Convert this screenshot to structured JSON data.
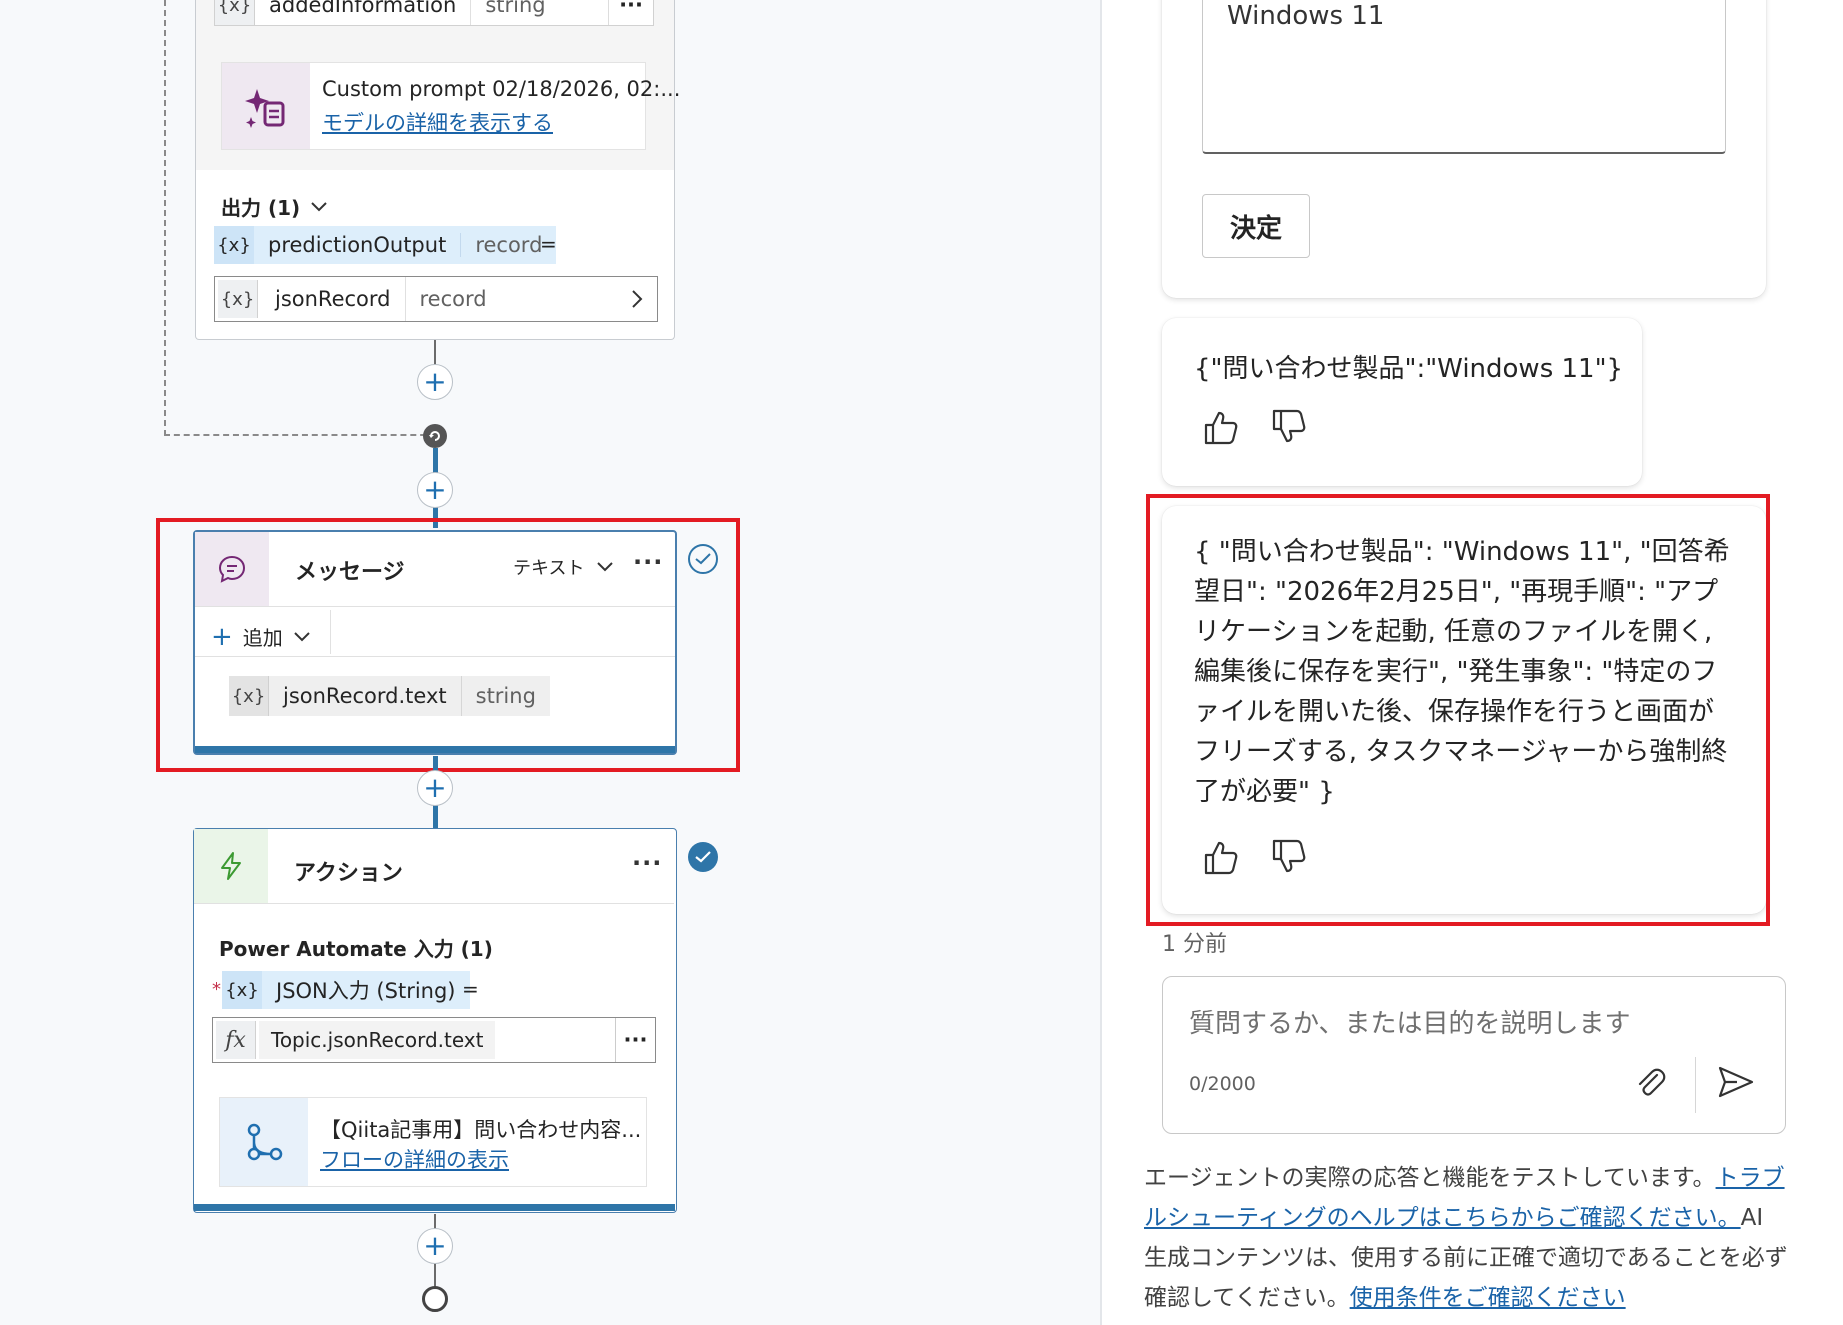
{
  "canvas": {
    "top_node": {
      "var_name": "addedInformation",
      "var_type": "string",
      "prompt_title": "Custom prompt 02/18/2026, 02:...",
      "prompt_link": "モデルの詳細を表示する",
      "output_label": "出力 (1)",
      "output_var": "predictionOutput",
      "output_type": "record",
      "eq": "=",
      "assign_var": "jsonRecord",
      "assign_type": "record"
    },
    "message_node": {
      "title": "メッセージ",
      "mode": "テキスト",
      "add_label": "追加",
      "var_name": "jsonRecord.text",
      "var_type": "string"
    },
    "action_node": {
      "title": "アクション",
      "inputs_label": "Power Automate 入力 (1)",
      "required_mark": "*",
      "input_name": "JSON入力 (String)",
      "eq": "=",
      "formula": "Topic.jsonRecord.text",
      "flow_title": "【Qiita記事用】問い合わせ内容...",
      "flow_link": "フローの詳細の表示"
    },
    "var_symbol": "{x}",
    "fx_symbol": "fx",
    "ellipsis": "···"
  },
  "panel": {
    "input_value": "Windows 11",
    "submit_label": "決定",
    "msg1": "{\"問い合わせ製品\":\"Windows 11\"}",
    "msg2": "{ \"問い合わせ製品\": \"Windows 11\", \"回答希望日\": \"2026年2月25日\", \"再現手順\": \"アプリケーションを起動, 任意のファイルを開く, 編集後に保存を実行\", \"発生事象\": \"特定のファイルを開いた後、保存操作を行うと画面がフリーズする, タスクマネージャーから強制終了が必要\" }",
    "timestamp": "1 分前",
    "chat_placeholder": "質問するか、または目的を説明します",
    "char_count": "0/2000",
    "disclaimer_prefix": "エージェントの実際の応答と機能をテストしています。",
    "disclaimer_link1": "トラブルシューティングのヘルプはこちらからご確認ください。",
    "disclaimer_mid": "AI 生成コンテンツは、使用する前に正確で適切であることを必ず確認してください。",
    "disclaimer_link2": "使用条件をご確認ください"
  },
  "colors": {
    "accent": "#2e75a8",
    "highlight": "#e31b23",
    "link": "#1a63a8"
  }
}
